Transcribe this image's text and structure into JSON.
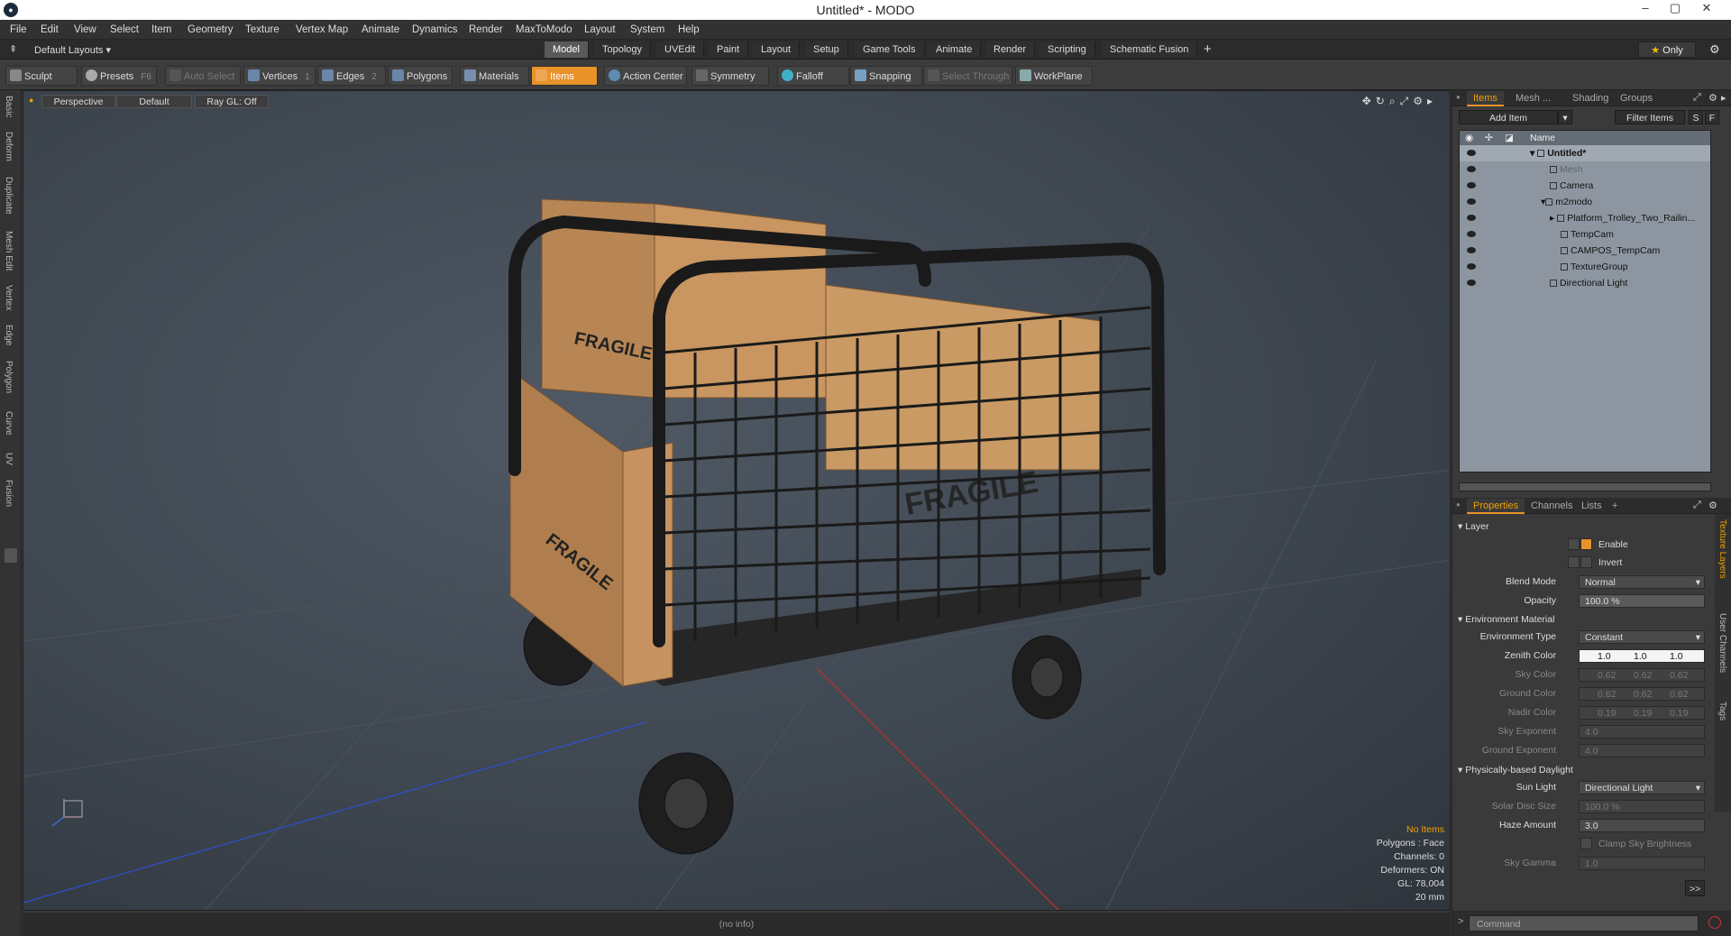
{
  "window": {
    "title": "Untitled* - MODO",
    "logo": "modo-logo-icon",
    "controls": [
      "–",
      "▢",
      "✕"
    ]
  },
  "menu": [
    "File",
    "Edit",
    "View",
    "Select",
    "Item",
    "Geometry",
    "Texture",
    "Vertex Map",
    "Animate",
    "Dynamics",
    "Render",
    "MaxToModo",
    "Layout",
    "System",
    "Help"
  ],
  "layoutbar": {
    "layouts_label": "Default Layouts",
    "tabs": [
      "Model",
      "Topology",
      "UVEdit",
      "Paint",
      "Layout",
      "Setup",
      "Game Tools",
      "Animate",
      "Render",
      "Scripting",
      "Schematic Fusion"
    ],
    "active_tab": "Model",
    "add": "+",
    "only_label": "Only"
  },
  "toolbar": {
    "sculpt": "Sculpt",
    "presets": "Presets",
    "presets_key": "F6",
    "auto_select": "Auto Select",
    "vertices": "Vertices",
    "vertices_key": "1",
    "edges": "Edges",
    "edges_key": "2",
    "polygons": "Polygons",
    "materials": "Materials",
    "items": "Items",
    "action_center": "Action Center",
    "symmetry": "Symmetry",
    "falloff": "Falloff",
    "snapping": "Snapping",
    "select_through": "Select Through",
    "workplane": "WorkPlane"
  },
  "left_tabs": [
    "Basic",
    "Deform",
    "Duplicate",
    "Mesh Edit",
    "Vertex",
    "Edge",
    "Polygon",
    "Curve",
    "UV",
    "Fusion"
  ],
  "viewport": {
    "view_mode": "Perspective",
    "shading": "Default",
    "raygl": "Ray GL: Off",
    "info": {
      "no_items": "No Items",
      "polygons": "Polygons : Face",
      "channels": "Channels: 0",
      "deformers": "Deformers: ON",
      "gl": "GL: 78,004",
      "unit": "20 mm"
    },
    "label_fragile": "FRAGILE"
  },
  "status": "(no info)",
  "items_panel": {
    "tabs": [
      "Items",
      "Mesh ...",
      "Shading",
      "Groups"
    ],
    "active_tab": "Items",
    "add_item": "Add Item",
    "filter_items": "Filter Items",
    "btn_s": "S",
    "btn_f": "F",
    "col_name": "Name",
    "tree": [
      {
        "name": "Untitled*",
        "indent": 0,
        "bold": true
      },
      {
        "name": "Mesh",
        "indent": 1,
        "dim": true
      },
      {
        "name": "Camera",
        "indent": 1
      },
      {
        "name": "m2modo",
        "indent": 1
      },
      {
        "name": "Platform_Trolley_Two_Railin...",
        "indent": 2
      },
      {
        "name": "TempCam",
        "indent": 2
      },
      {
        "name": "CAMPOS_TempCam",
        "indent": 2
      },
      {
        "name": "TextureGroup",
        "indent": 2
      },
      {
        "name": "Directional Light",
        "indent": 1
      }
    ]
  },
  "properties_panel": {
    "tabs": [
      "Properties",
      "Channels",
      "Lists",
      "+"
    ],
    "active_tab": "Properties",
    "sections": {
      "layer": "Layer",
      "env_material": "Environment Material",
      "daylight": "Physically-based Daylight"
    },
    "enable": "Enable",
    "invert": "Invert",
    "blend_mode_label": "Blend Mode",
    "blend_mode": "Normal",
    "opacity_label": "Opacity",
    "opacity": "100.0 %",
    "env_type_label": "Environment Type",
    "env_type": "Constant",
    "zenith_label": "Zenith Color",
    "zenith": [
      "1.0",
      "1.0",
      "1.0"
    ],
    "sky_label": "Sky Color",
    "sky": [
      "0.62",
      "0.62",
      "0.62"
    ],
    "ground_label": "Ground Color",
    "ground": [
      "0.62",
      "0.62",
      "0.62"
    ],
    "nadir_label": "Nadir Color",
    "nadir": [
      "0.19",
      "0.19",
      "0.19"
    ],
    "sky_exp_label": "Sky Exponent",
    "sky_exp": "4.0",
    "ground_exp_label": "Ground Exponent",
    "ground_exp": "4.0",
    "sun_light_label": "Sun Light",
    "sun_light": "Directional Light",
    "solar_disc_label": "Solar Disc Size",
    "solar_disc": "100.0 %",
    "haze_label": "Haze Amount",
    "haze": "3.0",
    "clamp": "Clamp Sky Brightness",
    "sky_gamma_label": "Sky Gamma",
    "sky_gamma": "1.0",
    "more": ">>"
  },
  "side_vtabs": [
    "Texture Layers",
    "User Channels",
    "Tags"
  ],
  "command": {
    "placeholder": "Command",
    "prompt": ">"
  },
  "colors": {
    "accent": "#e9922a",
    "viewport_bg": "#3e4650",
    "tree_bg": "#8d96a0"
  }
}
